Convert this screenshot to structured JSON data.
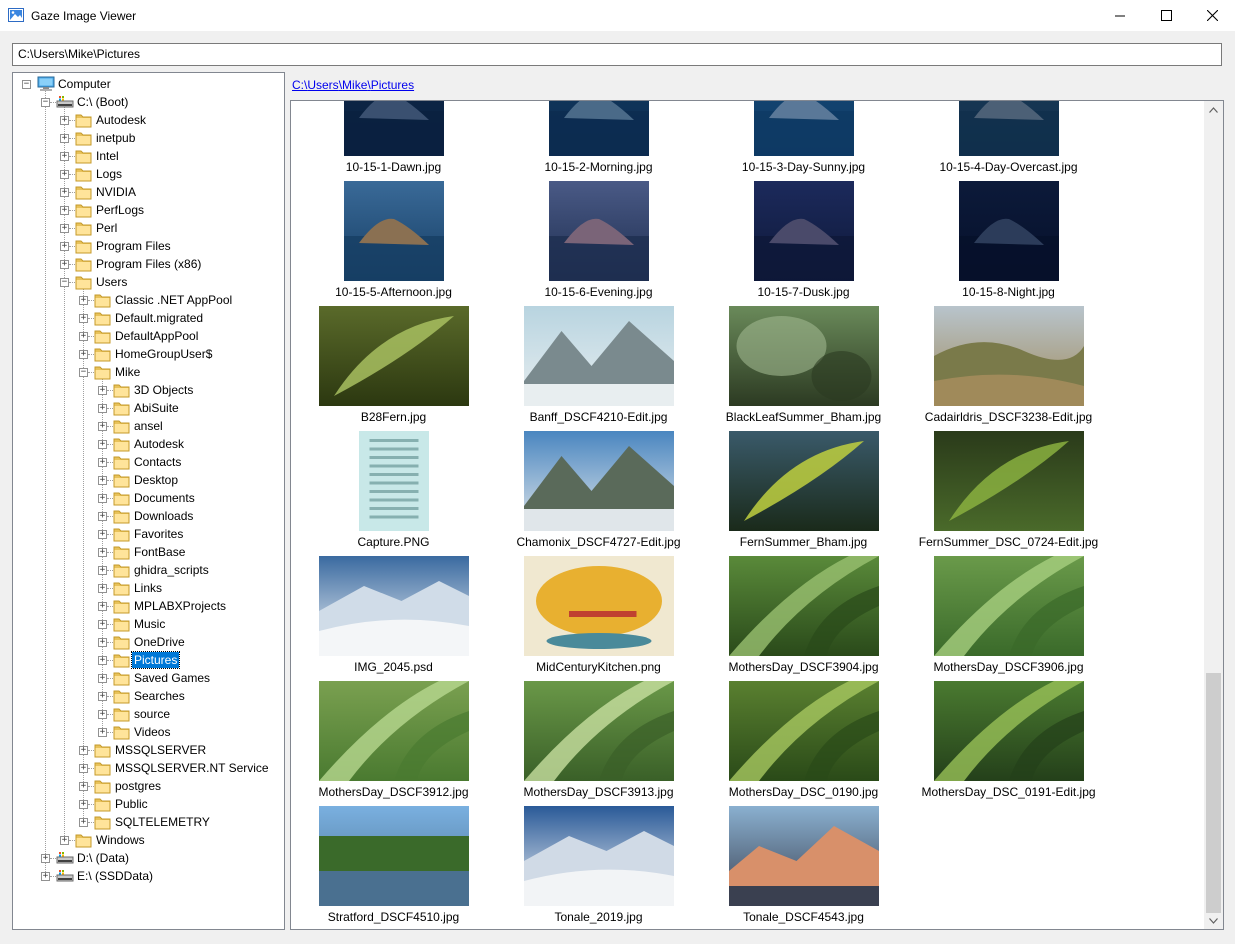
{
  "window": {
    "title": "Gaze Image Viewer",
    "minimize_icon": "minimize-icon",
    "maximize_icon": "maximize-icon",
    "close_icon": "close-icon"
  },
  "address_bar": {
    "value": "C:\\Users\\Mike\\Pictures"
  },
  "breadcrumb": {
    "parts": [
      "C:",
      "Users",
      "Mike",
      "Pictures"
    ],
    "separator": "\\"
  },
  "tree": [
    {
      "label": "Computer",
      "depth": 0,
      "state": "expanded",
      "icon": "computer-icon"
    },
    {
      "label": "C:\\ (Boot)",
      "depth": 1,
      "state": "expanded",
      "icon": "drive-icon"
    },
    {
      "label": "Autodesk",
      "depth": 2,
      "state": "collapsed",
      "icon": "folder-icon"
    },
    {
      "label": "inetpub",
      "depth": 2,
      "state": "collapsed",
      "icon": "folder-icon"
    },
    {
      "label": "Intel",
      "depth": 2,
      "state": "collapsed",
      "icon": "folder-icon"
    },
    {
      "label": "Logs",
      "depth": 2,
      "state": "collapsed",
      "icon": "folder-icon"
    },
    {
      "label": "NVIDIA",
      "depth": 2,
      "state": "collapsed",
      "icon": "folder-icon"
    },
    {
      "label": "PerfLogs",
      "depth": 2,
      "state": "collapsed",
      "icon": "folder-icon"
    },
    {
      "label": "Perl",
      "depth": 2,
      "state": "collapsed",
      "icon": "folder-icon"
    },
    {
      "label": "Program Files",
      "depth": 2,
      "state": "collapsed",
      "icon": "folder-icon"
    },
    {
      "label": "Program Files (x86)",
      "depth": 2,
      "state": "collapsed",
      "icon": "folder-icon"
    },
    {
      "label": "Users",
      "depth": 2,
      "state": "expanded",
      "icon": "folder-icon"
    },
    {
      "label": "Classic .NET AppPool",
      "depth": 3,
      "state": "collapsed",
      "icon": "folder-icon"
    },
    {
      "label": "Default.migrated",
      "depth": 3,
      "state": "collapsed",
      "icon": "folder-icon"
    },
    {
      "label": "DefaultAppPool",
      "depth": 3,
      "state": "collapsed",
      "icon": "folder-icon"
    },
    {
      "label": "HomeGroupUser$",
      "depth": 3,
      "state": "collapsed",
      "icon": "folder-icon"
    },
    {
      "label": "Mike",
      "depth": 3,
      "state": "expanded",
      "icon": "folder-icon"
    },
    {
      "label": "3D Objects",
      "depth": 4,
      "state": "collapsed",
      "icon": "folder-icon"
    },
    {
      "label": "AbiSuite",
      "depth": 4,
      "state": "collapsed",
      "icon": "folder-icon"
    },
    {
      "label": "ansel",
      "depth": 4,
      "state": "collapsed",
      "icon": "folder-icon"
    },
    {
      "label": "Autodesk",
      "depth": 4,
      "state": "collapsed",
      "icon": "folder-icon"
    },
    {
      "label": "Contacts",
      "depth": 4,
      "state": "collapsed",
      "icon": "folder-icon"
    },
    {
      "label": "Desktop",
      "depth": 4,
      "state": "collapsed",
      "icon": "folder-icon"
    },
    {
      "label": "Documents",
      "depth": 4,
      "state": "collapsed",
      "icon": "folder-icon"
    },
    {
      "label": "Downloads",
      "depth": 4,
      "state": "collapsed",
      "icon": "folder-icon"
    },
    {
      "label": "Favorites",
      "depth": 4,
      "state": "collapsed",
      "icon": "folder-icon"
    },
    {
      "label": "FontBase",
      "depth": 4,
      "state": "collapsed",
      "icon": "folder-icon"
    },
    {
      "label": "ghidra_scripts",
      "depth": 4,
      "state": "collapsed",
      "icon": "folder-icon"
    },
    {
      "label": "Links",
      "depth": 4,
      "state": "collapsed",
      "icon": "folder-icon"
    },
    {
      "label": "MPLABXProjects",
      "depth": 4,
      "state": "collapsed",
      "icon": "folder-icon"
    },
    {
      "label": "Music",
      "depth": 4,
      "state": "collapsed",
      "icon": "folder-icon"
    },
    {
      "label": "OneDrive",
      "depth": 4,
      "state": "collapsed",
      "icon": "folder-icon"
    },
    {
      "label": "Pictures",
      "depth": 4,
      "state": "collapsed",
      "icon": "folder-icon",
      "selected": true
    },
    {
      "label": "Saved Games",
      "depth": 4,
      "state": "collapsed",
      "icon": "folder-icon"
    },
    {
      "label": "Searches",
      "depth": 4,
      "state": "collapsed",
      "icon": "folder-icon"
    },
    {
      "label": "source",
      "depth": 4,
      "state": "collapsed",
      "icon": "folder-icon"
    },
    {
      "label": "Videos",
      "depth": 4,
      "state": "collapsed",
      "icon": "folder-icon"
    },
    {
      "label": "MSSQLSERVER",
      "depth": 3,
      "state": "collapsed",
      "icon": "folder-icon"
    },
    {
      "label": "MSSQLSERVER.NT Service",
      "depth": 3,
      "state": "collapsed",
      "icon": "folder-icon"
    },
    {
      "label": "postgres",
      "depth": 3,
      "state": "collapsed",
      "icon": "folder-icon"
    },
    {
      "label": "Public",
      "depth": 3,
      "state": "collapsed",
      "icon": "folder-icon"
    },
    {
      "label": "SQLTELEMETRY",
      "depth": 3,
      "state": "collapsed",
      "icon": "folder-icon"
    },
    {
      "label": "Windows",
      "depth": 2,
      "state": "collapsed",
      "icon": "folder-icon"
    },
    {
      "label": "D:\\ (Data)",
      "depth": 1,
      "state": "collapsed",
      "icon": "drive-icon"
    },
    {
      "label": "E:\\ (SSDData)",
      "depth": 1,
      "state": "collapsed",
      "icon": "drive-icon"
    }
  ],
  "thumbnails": [
    {
      "name": "10-15-1-Dawn.jpg",
      "kind": "island",
      "colors": [
        "#0d2848",
        "#3a5070",
        "#0a2040"
      ],
      "orient": "square",
      "cropped": true
    },
    {
      "name": "10-15-2-Morning.jpg",
      "kind": "island",
      "colors": [
        "#123a60",
        "#4a6a88",
        "#0c2c50"
      ],
      "orient": "square",
      "cropped": true
    },
    {
      "name": "10-15-3-Day-Sunny.jpg",
      "kind": "island",
      "colors": [
        "#164a78",
        "#5a7898",
        "#0e3a64"
      ],
      "orient": "square",
      "cropped": true
    },
    {
      "name": "10-15-4-Day-Overcast.jpg",
      "kind": "island",
      "colors": [
        "#1c3a58",
        "#4c6076",
        "#10304c"
      ],
      "orient": "square",
      "cropped": true
    },
    {
      "name": "10-15-5-Afternoon.jpg",
      "kind": "island",
      "colors": [
        "#3a6a98",
        "#8a7052",
        "#163e64"
      ],
      "orient": "square"
    },
    {
      "name": "10-15-6-Evening.jpg",
      "kind": "island",
      "colors": [
        "#4a5a86",
        "#7a6478",
        "#1e2e50"
      ],
      "orient": "square"
    },
    {
      "name": "10-15-7-Dusk.jpg",
      "kind": "island",
      "colors": [
        "#1c2a5c",
        "#4a4a6a",
        "#0e1838"
      ],
      "orient": "square"
    },
    {
      "name": "10-15-8-Night.jpg",
      "kind": "island",
      "colors": [
        "#0c1a3a",
        "#2c3c5a",
        "#06102a"
      ],
      "orient": "square"
    },
    {
      "name": "B28Fern.jpg",
      "kind": "leaf",
      "colors": [
        "#5a6a2a",
        "#a8c060",
        "#2c3810"
      ],
      "orient": "landscape"
    },
    {
      "name": "Banff_DSCF4210-Edit.jpg",
      "kind": "mountain",
      "colors": [
        "#b8d4e0",
        "#7a8a8e",
        "#e8eef0"
      ],
      "orient": "landscape"
    },
    {
      "name": "BlackLeafSummer_Bham.jpg",
      "kind": "blur",
      "colors": [
        "#6a8a5a",
        "#a0b890",
        "#2c3a22"
      ],
      "orient": "landscape"
    },
    {
      "name": "Cadairldris_DSCF3238-Edit.jpg",
      "kind": "hills",
      "colors": [
        "#b8c4cc",
        "#7a7a4a",
        "#a08a5a"
      ],
      "orient": "landscape"
    },
    {
      "name": "Capture.PNG",
      "kind": "screen",
      "colors": [
        "#9ad0d0",
        "#5a8a8a",
        "#c8e8e8"
      ],
      "orient": "portrait"
    },
    {
      "name": "Chamonix_DSCF4727-Edit.jpg",
      "kind": "mountain",
      "colors": [
        "#4a86c0",
        "#5a6a5a",
        "#e0e6ea"
      ],
      "orient": "landscape"
    },
    {
      "name": "FernSummer_Bham.jpg",
      "kind": "leaf",
      "colors": [
        "#3a5a6a",
        "#c0d040",
        "#1a2a1a"
      ],
      "orient": "landscape"
    },
    {
      "name": "FernSummer_DSC_0724-Edit.jpg",
      "kind": "leaf",
      "colors": [
        "#2a3a1a",
        "#8ab040",
        "#4a6a2a"
      ],
      "orient": "landscape"
    },
    {
      "name": "IMG_2045.psd",
      "kind": "snow",
      "colors": [
        "#3a6aa0",
        "#d0dce8",
        "#f4f6f8"
      ],
      "orient": "landscape"
    },
    {
      "name": "MidCenturyKitchen.png",
      "kind": "kitchen",
      "colors": [
        "#f0e8d0",
        "#e8b030",
        "#c04030"
      ],
      "orient": "landscape"
    },
    {
      "name": "MothersDay_DSCF3904.jpg",
      "kind": "grass",
      "colors": [
        "#5a8a3a",
        "#9ac070",
        "#2a4a1a"
      ],
      "orient": "landscape"
    },
    {
      "name": "MothersDay_DSCF3906.jpg",
      "kind": "grass",
      "colors": [
        "#6a9a4a",
        "#a8d080",
        "#3a6a2a"
      ],
      "orient": "landscape"
    },
    {
      "name": "MothersDay_DSCF3912.jpg",
      "kind": "grass",
      "colors": [
        "#7aa050",
        "#b8d890",
        "#4a7a30"
      ],
      "orient": "landscape"
    },
    {
      "name": "MothersDay_DSCF3913.jpg",
      "kind": "grass",
      "colors": [
        "#6a9848",
        "#c8e0a0",
        "#3a6028"
      ],
      "orient": "landscape"
    },
    {
      "name": "MothersDay_DSC_0190.jpg",
      "kind": "grass",
      "colors": [
        "#5a8030",
        "#a8c860",
        "#2a4a18"
      ],
      "orient": "landscape"
    },
    {
      "name": "MothersDay_DSC_0191-Edit.jpg",
      "kind": "grass",
      "colors": [
        "#4a7a30",
        "#98c058",
        "#24401a"
      ],
      "orient": "landscape"
    },
    {
      "name": "Stratford_DSCF4510.jpg",
      "kind": "river",
      "colors": [
        "#7ab0e0",
        "#3a6a2a",
        "#4a7090"
      ],
      "orient": "landscape"
    },
    {
      "name": "Tonale_2019.jpg",
      "kind": "snow",
      "colors": [
        "#2a5a98",
        "#d0dae6",
        "#f2f4f6"
      ],
      "orient": "landscape"
    },
    {
      "name": "Tonale_DSCF4543.jpg",
      "kind": "alpenglow",
      "colors": [
        "#8ab0d0",
        "#d8906a",
        "#3a4050"
      ],
      "orient": "landscape"
    }
  ]
}
